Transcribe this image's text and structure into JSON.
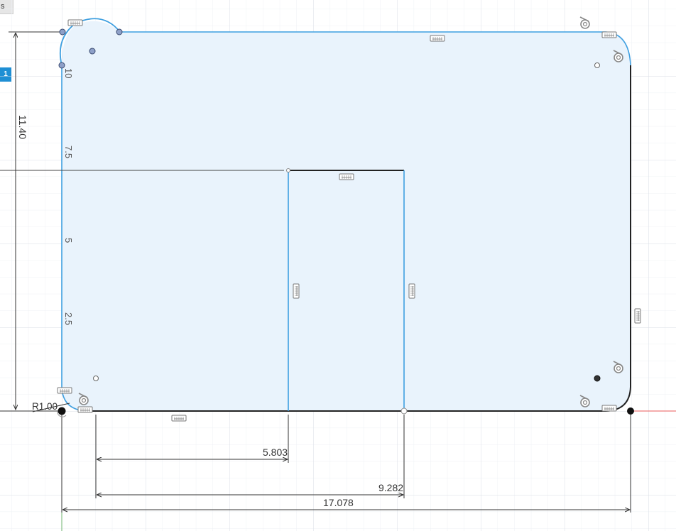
{
  "ui": {
    "tab_label": "s",
    "selection_badge": "1"
  },
  "colors": {
    "grid_minor": "#eef1f5",
    "grid_major": "#d9dee6",
    "profile_fill": "#e9f3fc",
    "sketch_blue": "#3e9fe0",
    "fixed_black": "#222222",
    "dim_text": "#333333",
    "axis_red": "#e85a5a",
    "point_fill": "#8ea0c8"
  },
  "axis_ticks": [
    {
      "label": "10"
    },
    {
      "label": "7.5"
    },
    {
      "label": "5"
    },
    {
      "label": "2.5"
    }
  ],
  "dimensions": {
    "height": "11.40",
    "radius": "R1.00",
    "d1": "5.803",
    "d2": "9.282",
    "d3": "17.078"
  },
  "icons": {
    "constraint": "horizontal-constraint-icon",
    "tangent": "tangent-constraint-icon",
    "fixed_point": "fixed-point-icon"
  }
}
